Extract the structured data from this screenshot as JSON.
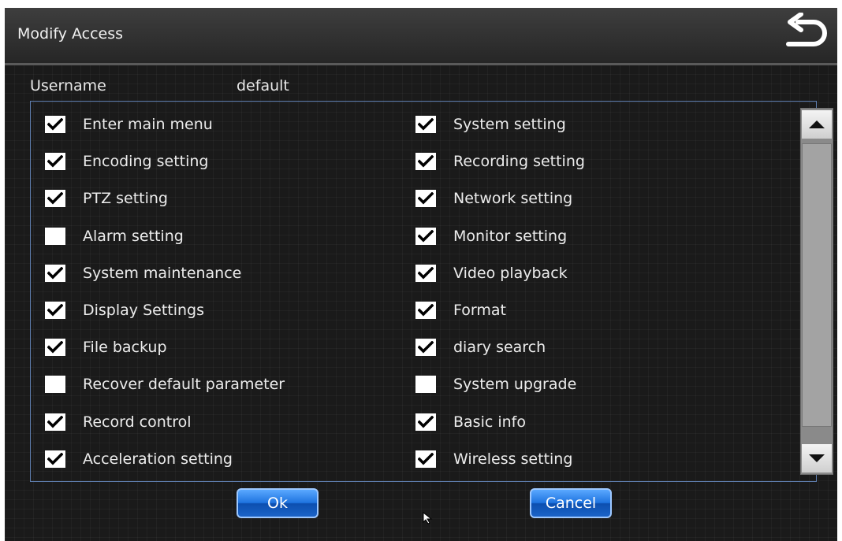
{
  "window": {
    "title": "Modify Access"
  },
  "user": {
    "label": "Username",
    "value": "default"
  },
  "permissions": {
    "left": [
      {
        "label": "Enter main menu",
        "checked": true
      },
      {
        "label": "Encoding setting",
        "checked": true
      },
      {
        "label": "PTZ setting",
        "checked": true
      },
      {
        "label": "Alarm setting",
        "checked": false
      },
      {
        "label": "System maintenance",
        "checked": true
      },
      {
        "label": "Display Settings",
        "checked": true
      },
      {
        "label": "File backup",
        "checked": true
      },
      {
        "label": "Recover default parameter",
        "checked": false
      },
      {
        "label": "Record control",
        "checked": true
      },
      {
        "label": "Acceleration setting",
        "checked": true
      }
    ],
    "right": [
      {
        "label": "System setting",
        "checked": true
      },
      {
        "label": "Recording setting",
        "checked": true
      },
      {
        "label": "Network setting",
        "checked": true
      },
      {
        "label": "Monitor  setting",
        "checked": true
      },
      {
        "label": "Video playback",
        "checked": true
      },
      {
        "label": "Format",
        "checked": true
      },
      {
        "label": "diary search",
        "checked": true
      },
      {
        "label": "System upgrade",
        "checked": false
      },
      {
        "label": "Basic info",
        "checked": true
      },
      {
        "label": "Wireless setting",
        "checked": true
      }
    ]
  },
  "buttons": {
    "ok": "Ok",
    "cancel": "Cancel"
  },
  "icons": {
    "back": "return-arrow-icon",
    "check": "checkmark-icon",
    "scroll_up": "triangle-up-icon",
    "scroll_down": "triangle-down-icon",
    "cursor": "mouse-pointer-icon"
  }
}
